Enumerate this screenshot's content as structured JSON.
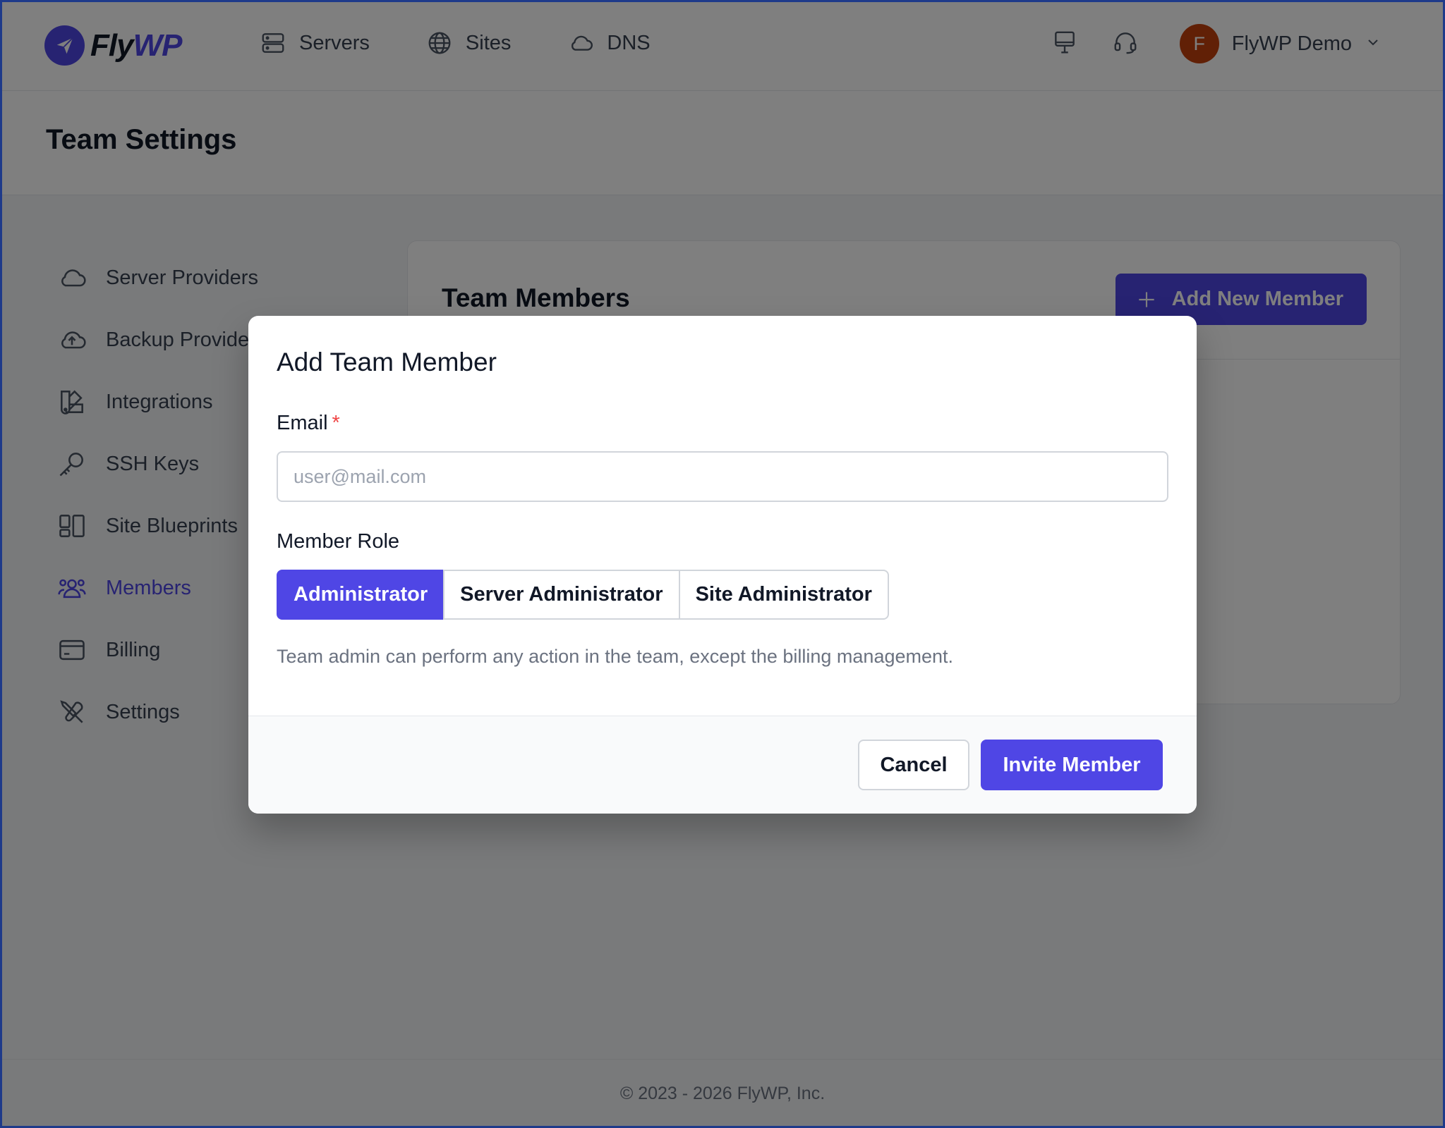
{
  "brand": {
    "name_fly": "Fly",
    "name_wp": "WP",
    "accent": "#4f46e5"
  },
  "nav": {
    "items": [
      {
        "label": "Servers",
        "icon": "server-icon"
      },
      {
        "label": "Sites",
        "icon": "globe-icon"
      },
      {
        "label": "DNS",
        "icon": "cloud-icon"
      }
    ]
  },
  "user": {
    "initial": "F",
    "name": "FlyWP Demo",
    "avatar_color": "#c2410c"
  },
  "page": {
    "title": "Team Settings"
  },
  "sidebar": {
    "items": [
      {
        "label": "Server Providers",
        "icon": "cloud-icon"
      },
      {
        "label": "Backup Providers",
        "icon": "cloud-upload-icon"
      },
      {
        "label": "Integrations",
        "icon": "swatch-icon"
      },
      {
        "label": "SSH Keys",
        "icon": "key-icon"
      },
      {
        "label": "Site Blueprints",
        "icon": "blueprint-icon"
      },
      {
        "label": "Members",
        "icon": "users-icon",
        "active": true
      },
      {
        "label": "Billing",
        "icon": "credit-card-icon"
      },
      {
        "label": "Settings",
        "icon": "wrench-screwdriver-icon"
      }
    ]
  },
  "card": {
    "title": "Team Members",
    "add_button": "Add New Member"
  },
  "modal": {
    "title": "Add Team Member",
    "email_label": "Email",
    "required_mark": "*",
    "email_placeholder": "user@mail.com",
    "email_value": "",
    "role_label": "Member Role",
    "roles": [
      "Administrator",
      "Server Administrator",
      "Site Administrator"
    ],
    "selected_role": "Administrator",
    "role_description": "Team admin can perform any action in the team, except the billing management.",
    "cancel_label": "Cancel",
    "invite_label": "Invite Member"
  },
  "footer": {
    "text": "© 2023 - 2026 FlyWP, Inc."
  }
}
